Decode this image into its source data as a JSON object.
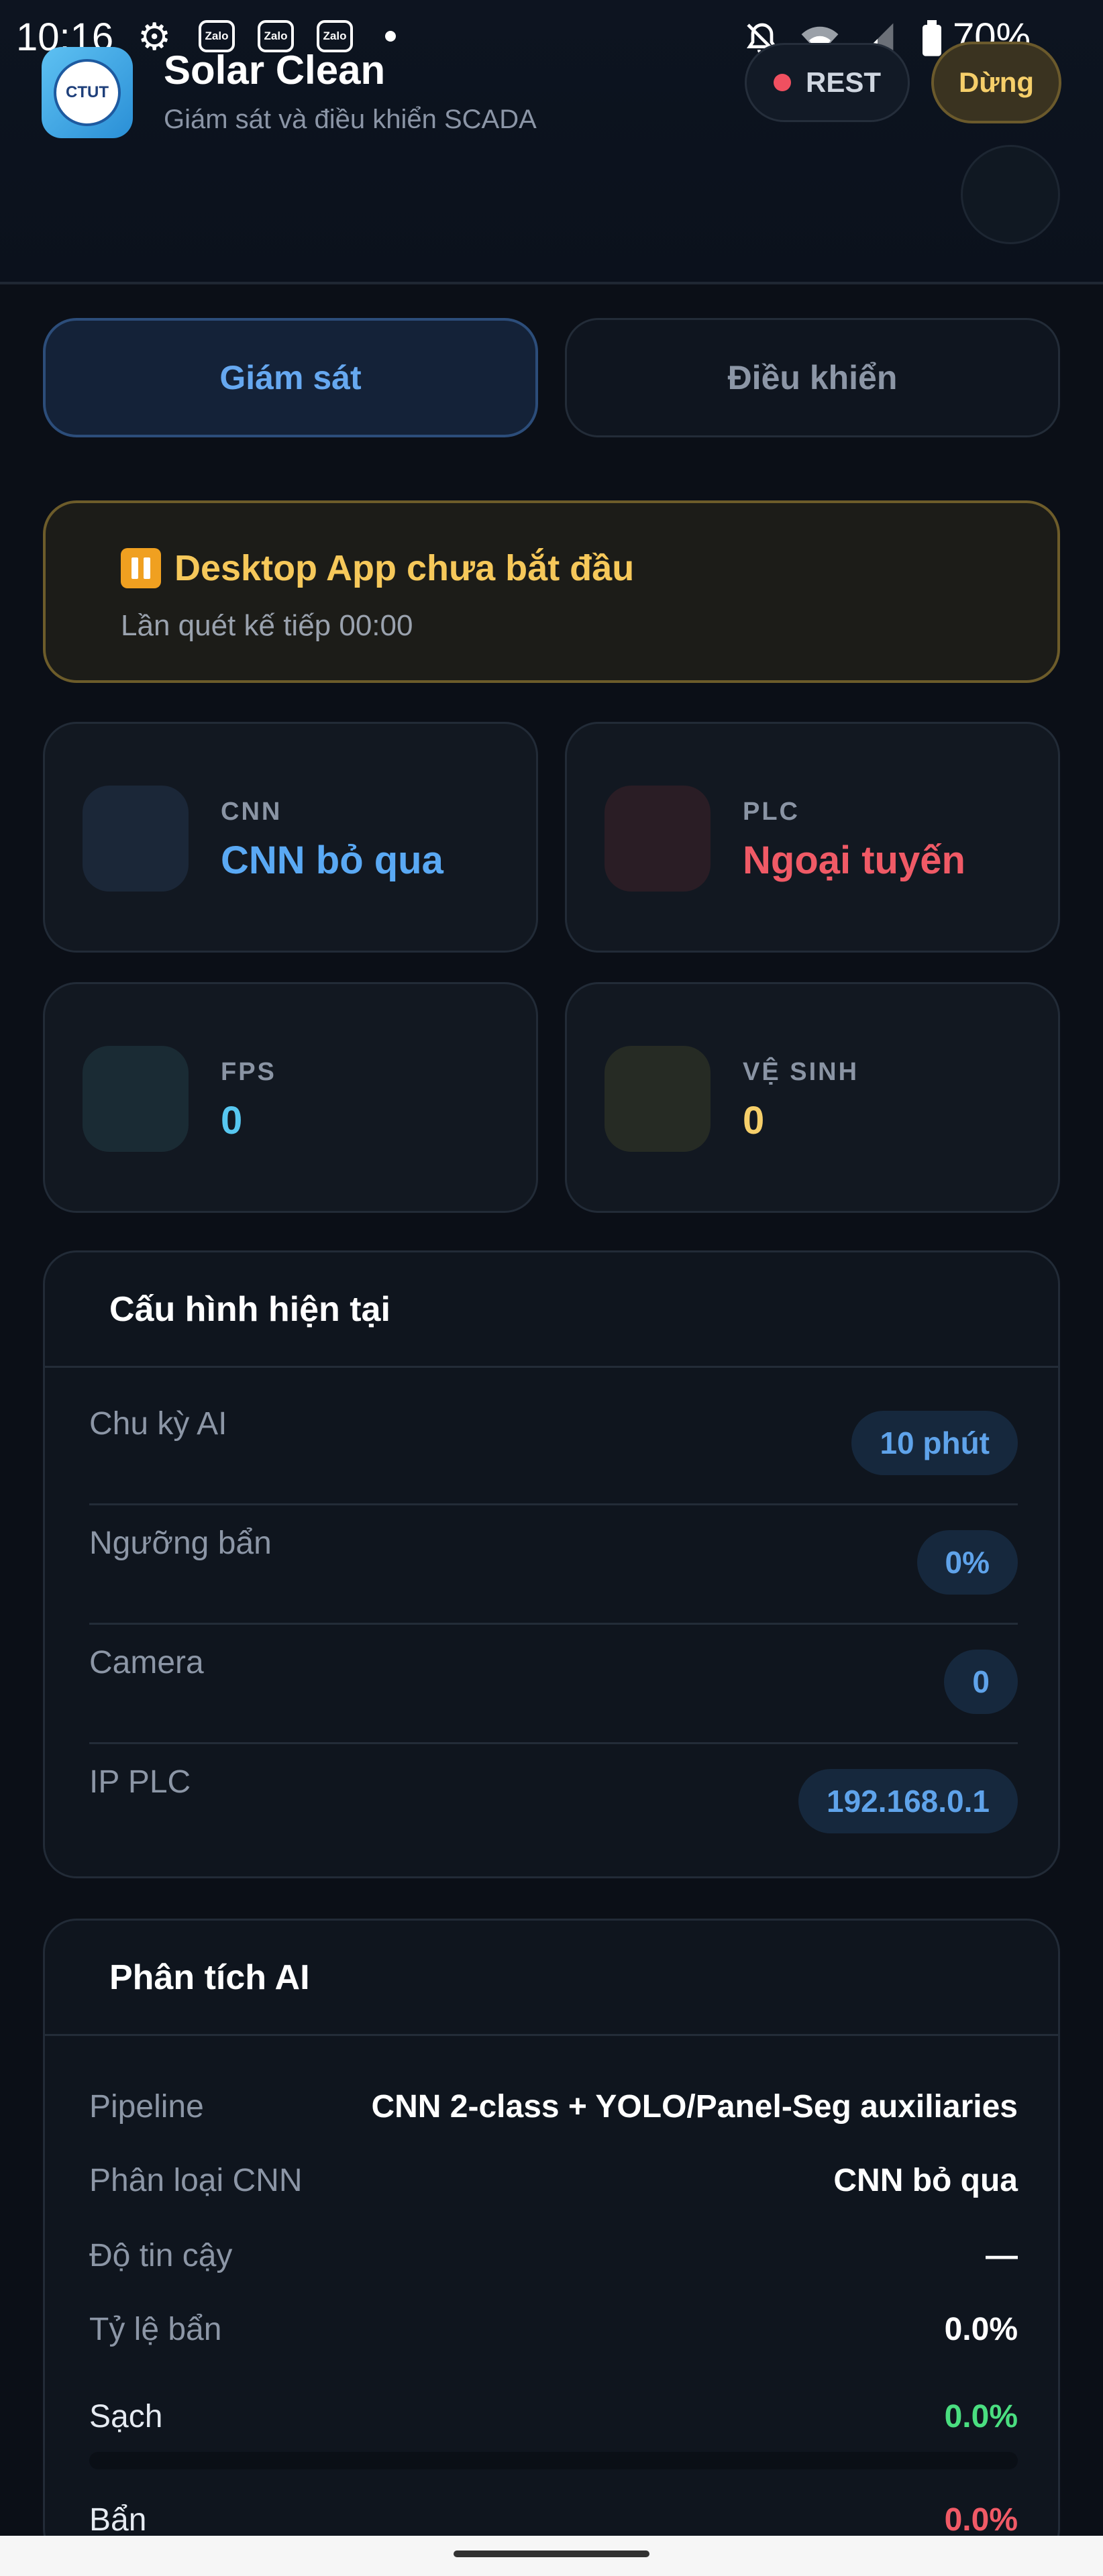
{
  "status_bar": {
    "time": "10:16",
    "zalo": "Zalo",
    "battery": "70%"
  },
  "header": {
    "logo_text": "CTUT",
    "title": "Solar Clean",
    "subtitle": "Giám sát và điều khiển SCADA",
    "rest_label": "REST",
    "stop_label": "Dừng"
  },
  "tabs": [
    {
      "label": "Giám sát"
    },
    {
      "label": "Điều khiển"
    }
  ],
  "alert": {
    "title": "Desktop App chưa bắt đầu",
    "subtitle": "Lần quét kế tiếp 00:00"
  },
  "cards": [
    {
      "label": "CNN",
      "value": "CNN bỏ qua",
      "color": "#5aa9f4",
      "icon_bg": "#1b2738"
    },
    {
      "label": "PLC",
      "value": "Ngoại tuyến",
      "color": "#f05a66",
      "icon_bg": "#2a1d25"
    },
    {
      "label": "FPS",
      "value": "0",
      "color": "#57c7f0",
      "icon_bg": "#1a2b34"
    },
    {
      "label": "VỆ SINH",
      "value": "0",
      "color": "#f6cf6a",
      "icon_bg": "#262b24"
    }
  ],
  "config": {
    "title": "Cấu hình hiện tại",
    "rows": [
      {
        "label": "Chu kỳ AI",
        "value": "10 phút"
      },
      {
        "label": "Ngưỡng bẩn",
        "value": "0%"
      },
      {
        "label": "Camera",
        "value": "0"
      },
      {
        "label": "IP PLC",
        "value": "192.168.0.1"
      }
    ]
  },
  "ai": {
    "title": "Phân tích AI",
    "rows": [
      {
        "label": "Pipeline",
        "value": "CNN 2-class + YOLO/Panel-Seg auxiliaries"
      },
      {
        "label": "Phân loại CNN",
        "value": "CNN bỏ qua"
      },
      {
        "label": "Độ tin cậy",
        "value": "—"
      },
      {
        "label": "Tỷ lệ bẩn",
        "value": "0.0%"
      }
    ],
    "clean": {
      "label": "Sạch",
      "value": "0.0%",
      "color": "#4ade80",
      "fraction": 0
    },
    "dirty": {
      "label": "Bẩn",
      "value": "0.0%",
      "color": "#f05a66",
      "fraction": 0
    }
  }
}
